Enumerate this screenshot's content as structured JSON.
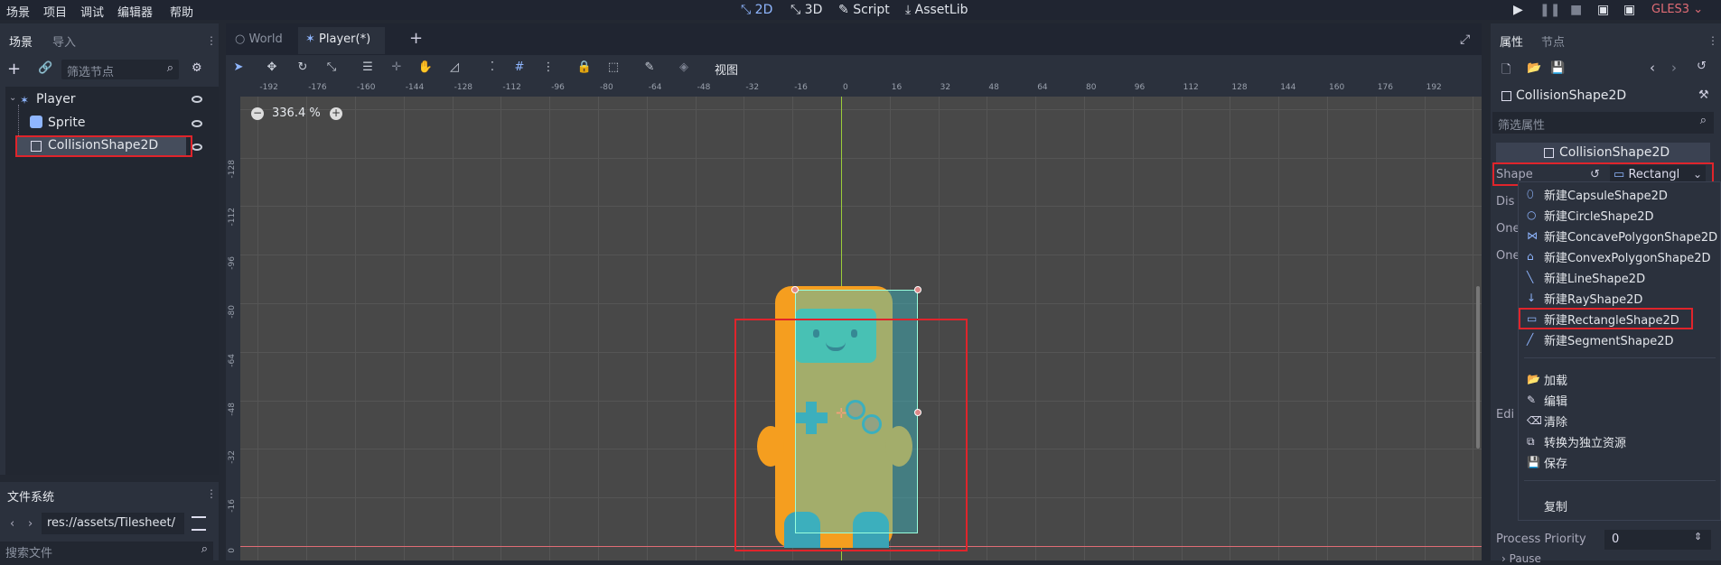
{
  "menu": [
    "场景",
    "项目",
    "调试",
    "编辑器",
    "帮助"
  ],
  "workspaces": {
    "d2": "2D",
    "d3": "3D",
    "script": "Script",
    "assetlib": "AssetLib"
  },
  "renderer": "GLES3",
  "scene_dock": {
    "tabs": [
      "场景",
      "导入"
    ],
    "filter_placeholder": "筛选节点",
    "nodes": [
      {
        "label": "Player"
      },
      {
        "label": "Sprite"
      },
      {
        "label": "CollisionShape2D"
      }
    ]
  },
  "filesystem": {
    "title": "文件系统",
    "path": "res://assets/Tilesheet/",
    "search_placeholder": "搜索文件"
  },
  "editor_tabs": [
    {
      "label": "World"
    },
    {
      "label": "Player(*)"
    }
  ],
  "toolbar": {
    "view": "视图"
  },
  "viewport": {
    "zoom": "336.4 %",
    "ruler_h": [
      "-192",
      "-176",
      "-160",
      "-144",
      "-128",
      "-112",
      "-96",
      "-80",
      "-64",
      "-48",
      "-32",
      "-16",
      "0",
      "16",
      "32",
      "48",
      "64",
      "80",
      "96",
      "112",
      "128",
      "144",
      "160",
      "176",
      "192"
    ],
    "ruler_v": [
      "-128",
      "-112",
      "-96",
      "-80",
      "-64",
      "-48",
      "-32",
      "-16",
      "0"
    ]
  },
  "inspector": {
    "tabs": [
      "属性",
      "节点"
    ],
    "node": "CollisionShape2D",
    "filter_placeholder": "筛选属性",
    "section": "CollisionShape2D",
    "shape_label": "Shape",
    "shape_value": "Rectangl",
    "partial_rows": [
      "Dis",
      "One",
      "One",
      "Edi"
    ],
    "process_priority_label": "Process Priority",
    "process_priority_value": "0",
    "pause_label": "Pause"
  },
  "dropdown": {
    "new_items": [
      "新建CapsuleShape2D",
      "新建CircleShape2D",
      "新建ConcavePolygonShape2D",
      "新建ConvexPolygonShape2D",
      "新建LineShape2D",
      "新建RayShape2D",
      "新建RectangleShape2D",
      "新建SegmentShape2D"
    ],
    "actions": [
      "加载",
      "编辑",
      "清除",
      "转换为独立资源",
      "保存"
    ],
    "copy": "复制"
  },
  "colors": {
    "accent": "#8fb6ff",
    "highlight": "#e0242b",
    "renderer": "#e06c75"
  }
}
